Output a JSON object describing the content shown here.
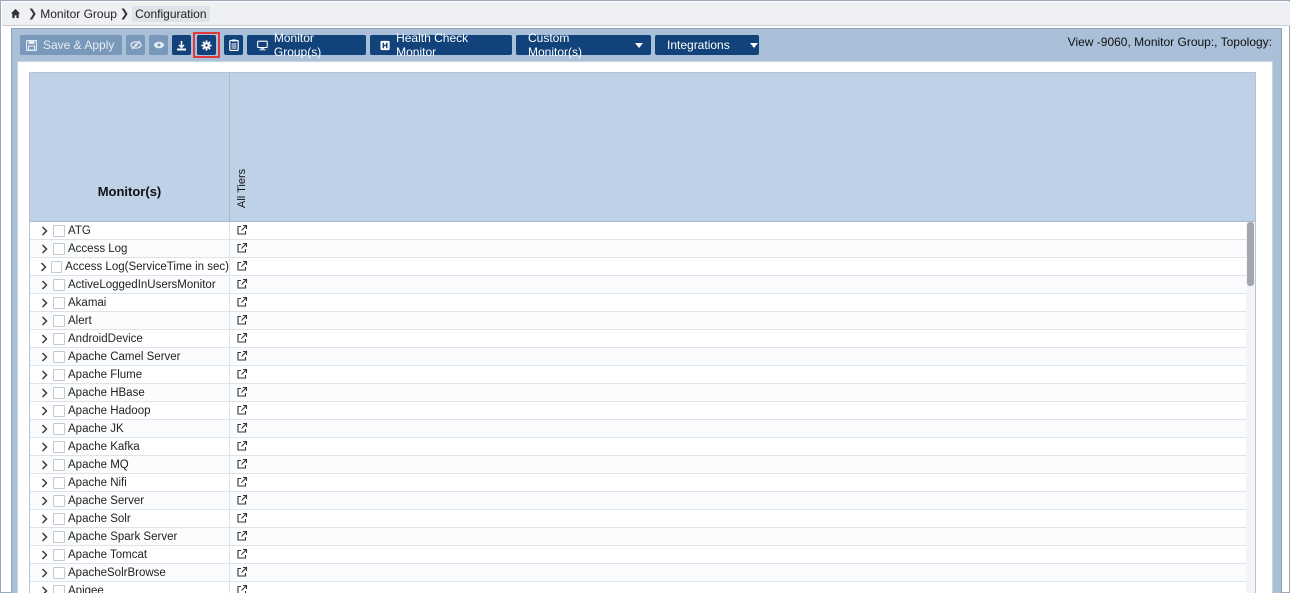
{
  "breadcrumb": {
    "items": [
      "Monitor Group",
      "Configuration"
    ]
  },
  "toolbar": {
    "save_label": "Save & Apply",
    "monitor_groups_label": "Monitor Group(s)",
    "health_check_label": "Health Check Monitor",
    "custom_monitors_label": "Custom Monitor(s)",
    "integrations_label": "Integrations",
    "view_info": "View -9060, Monitor Group:, Topology:"
  },
  "table": {
    "col_monitors": "Monitor(s)",
    "col_tiers": "All Tiers",
    "rows": [
      "ATG",
      "Access Log",
      "Access Log(ServiceTime in sec)",
      "ActiveLoggedInUsersMonitor",
      "Akamai",
      "Alert",
      "AndroidDevice",
      "Apache Camel Server",
      "Apache Flume",
      "Apache HBase",
      "Apache Hadoop",
      "Apache JK",
      "Apache Kafka",
      "Apache MQ",
      "Apache Nifi",
      "Apache Server",
      "Apache Solr",
      "Apache Spark Server",
      "Apache Tomcat",
      "ApacheSolrBrowse",
      "Apigee"
    ]
  },
  "colors": {
    "toolbar_bg": "#a9c0d8",
    "button_dark": "#12427a",
    "button_disabled": "#7a98b9",
    "header_bg": "#bfd1e6",
    "highlight": "#e03a3a"
  },
  "icons": {
    "home": "home-icon",
    "save": "save-icon",
    "hide": "eye-slash-icon",
    "view": "eye-icon",
    "download": "download-icon",
    "settings": "gear-icon",
    "clipboard": "clipboard-icon",
    "monitor": "monitor-icon",
    "health": "hospital-icon",
    "external": "external-link-icon"
  }
}
